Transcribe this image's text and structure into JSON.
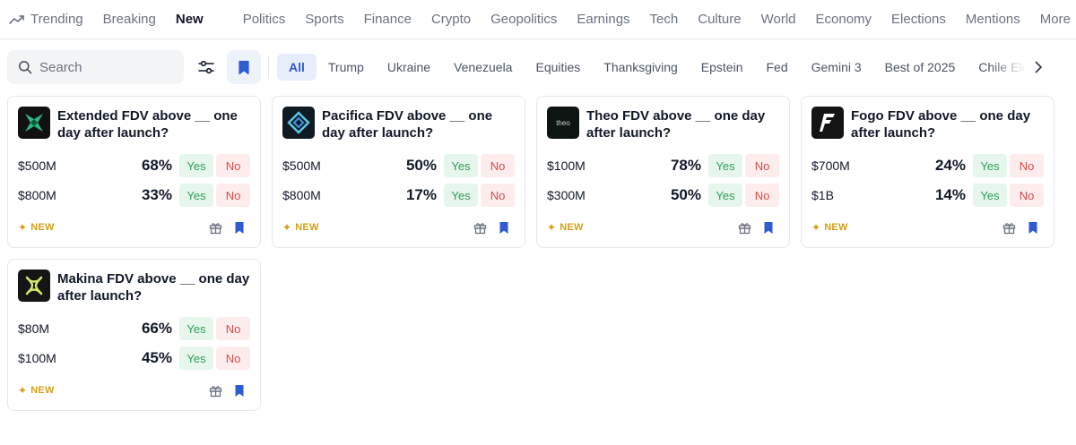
{
  "nav": {
    "items": [
      {
        "label": "Trending",
        "icon": "trending-icon"
      },
      {
        "label": "Breaking"
      },
      {
        "label": "New",
        "active": true
      }
    ],
    "categories": [
      {
        "label": "Politics"
      },
      {
        "label": "Sports"
      },
      {
        "label": "Finance"
      },
      {
        "label": "Crypto"
      },
      {
        "label": "Geopolitics"
      },
      {
        "label": "Earnings"
      },
      {
        "label": "Tech"
      },
      {
        "label": "Culture"
      },
      {
        "label": "World"
      },
      {
        "label": "Economy"
      },
      {
        "label": "Elections"
      },
      {
        "label": "Mentions"
      }
    ],
    "more_label": "More"
  },
  "search": {
    "placeholder": "Search"
  },
  "filters": {
    "chips": [
      {
        "label": "All",
        "active": true
      },
      {
        "label": "Trump"
      },
      {
        "label": "Ukraine"
      },
      {
        "label": "Venezuela"
      },
      {
        "label": "Equities"
      },
      {
        "label": "Thanksgiving"
      },
      {
        "label": "Epstein"
      },
      {
        "label": "Fed"
      },
      {
        "label": "Gemini 3"
      },
      {
        "label": "Best of 2025"
      },
      {
        "label": "Chile Elec"
      }
    ]
  },
  "colors": {
    "accent": "#2f5bd3",
    "yes_bg": "#e7f6ec",
    "yes_text": "#2f9e58",
    "no_bg": "#fdecec",
    "no_text": "#d94b4b",
    "new_badge": "#d4a017"
  },
  "markets": [
    {
      "title": "Extended FDV above __ one day after launch?",
      "logo": "extended-logo",
      "outcomes": [
        {
          "label": "$500M",
          "pct": "68%"
        },
        {
          "label": "$800M",
          "pct": "33%"
        }
      ],
      "badge": "NEW",
      "yes_label": "Yes",
      "no_label": "No"
    },
    {
      "title": "Pacifica FDV above __ one day after launch?",
      "logo": "pacifica-logo",
      "outcomes": [
        {
          "label": "$500M",
          "pct": "50%"
        },
        {
          "label": "$800M",
          "pct": "17%"
        }
      ],
      "badge": "NEW",
      "yes_label": "Yes",
      "no_label": "No"
    },
    {
      "title": "Theo FDV above __ one day after launch?",
      "logo": "theo-logo",
      "logo_text": "theo",
      "outcomes": [
        {
          "label": "$100M",
          "pct": "78%"
        },
        {
          "label": "$300M",
          "pct": "50%"
        }
      ],
      "badge": "NEW",
      "yes_label": "Yes",
      "no_label": "No"
    },
    {
      "title": "Fogo FDV above __ one day after launch?",
      "logo": "fogo-logo",
      "outcomes": [
        {
          "label": "$700M",
          "pct": "24%"
        },
        {
          "label": "$1B",
          "pct": "14%"
        }
      ],
      "badge": "NEW",
      "yes_label": "Yes",
      "no_label": "No"
    },
    {
      "title": "Makina FDV above __ one day after launch?",
      "logo": "makina-logo",
      "outcomes": [
        {
          "label": "$80M",
          "pct": "66%"
        },
        {
          "label": "$100M",
          "pct": "45%"
        }
      ],
      "badge": "NEW",
      "yes_label": "Yes",
      "no_label": "No"
    }
  ]
}
